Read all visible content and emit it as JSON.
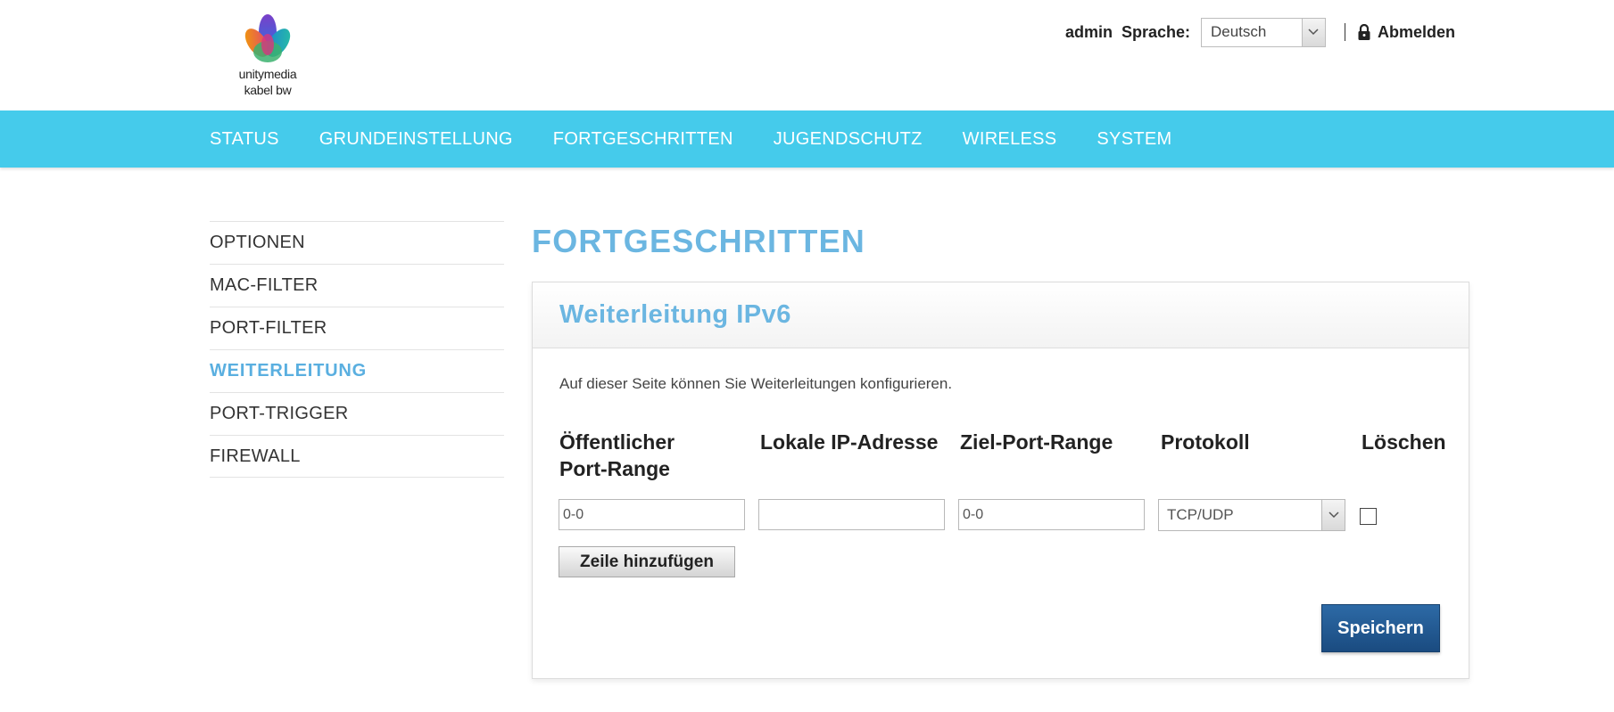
{
  "header": {
    "logo_line1": "unitymedia",
    "logo_line2": "kabel bw",
    "user": "admin",
    "language_label": "Sprache:",
    "language_value": "Deutsch",
    "logout_label": "Abmelden"
  },
  "nav": {
    "items": [
      "STATUS",
      "GRUNDEINSTELLUNG",
      "FORTGESCHRITTEN",
      "JUGENDSCHUTZ",
      "WIRELESS",
      "SYSTEM"
    ]
  },
  "sidebar": {
    "items": [
      "OPTIONEN",
      "MAC-FILTER",
      "PORT-FILTER",
      "WEITERLEITUNG",
      "PORT-TRIGGER",
      "FIREWALL"
    ],
    "active": "WEITERLEITUNG"
  },
  "main": {
    "page_title": "FORTGESCHRITTEN",
    "panel_title": "Weiterleitung IPv6",
    "description": "Auf dieser Seite können Sie Weiterleitungen konfigurieren.",
    "columns": {
      "public_port_line1": "Öffentlicher",
      "public_port_line2": "Port-Range",
      "local_ip": "Lokale IP-Adresse",
      "target_port": "Ziel-Port-Range",
      "protocol": "Protokoll",
      "delete": "Löschen"
    },
    "row": {
      "public_port_value": "0-0",
      "local_ip_value": "",
      "target_port_value": "0-0",
      "protocol_value": "TCP/UDP",
      "delete_checked": false
    },
    "add_row_label": "Zeile hinzufügen",
    "save_label": "Speichern"
  },
  "colors": {
    "nav_bg": "#45cbeb",
    "title_blue": "#6bb6e1",
    "save_button": "#1f5691"
  }
}
